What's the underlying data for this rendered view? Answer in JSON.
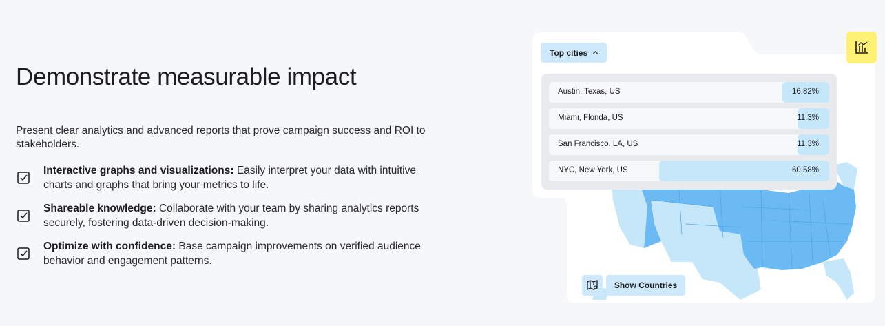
{
  "heading": "Demonstrate measurable impact",
  "intro": "Present clear analytics and advanced reports that prove campaign success and ROI to stakeholders.",
  "features": [
    {
      "title": "Interactive graphs and visualizations:",
      "body": "Easily interpret your data with intuitive charts and graphs that bring your metrics to life."
    },
    {
      "title": "Shareable knowledge:",
      "body": "Collaborate with your team by sharing analytics reports securely, fostering data-driven decision-making."
    },
    {
      "title": "Optimize with confidence:",
      "body": "Base campaign improvements on verified audience behavior and engagement patterns."
    }
  ],
  "widget": {
    "dropdown_label": "Top cities",
    "cities": [
      {
        "name": "Austin, Texas, US",
        "percent": "16.82%",
        "share": 0.1682
      },
      {
        "name": "Miami, Florida, US",
        "percent": "11.3%",
        "share": 0.113
      },
      {
        "name": "San Francisco, LA, US",
        "percent": "11.3%",
        "share": 0.113
      },
      {
        "name": "NYC, New York, US",
        "percent": "60.58%",
        "share": 0.6058
      }
    ],
    "show_countries_label": "Show Countries",
    "icons": {
      "chart": "bar-chart-icon",
      "map": "map-pin-icon",
      "chevron": "chevron-up-icon",
      "check": "checkbox-checked-icon"
    },
    "colors": {
      "accent_yellow": "#fff176",
      "light_blue": "#cde9fb",
      "map_blue": "#6bbaf3",
      "map_light": "#c6e6fa"
    }
  }
}
